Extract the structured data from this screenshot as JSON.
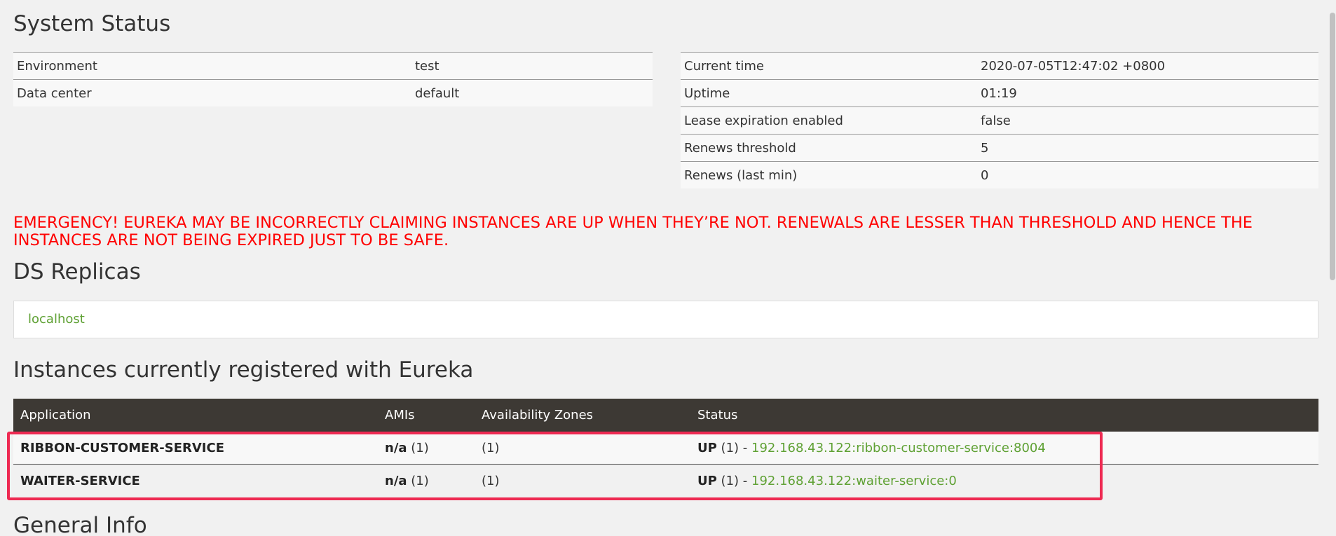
{
  "system_status": {
    "title": "System Status",
    "left_rows": [
      {
        "label": "Environment",
        "value": "test"
      },
      {
        "label": "Data center",
        "value": "default"
      }
    ],
    "right_rows": [
      {
        "label": "Current time",
        "value": "2020-07-05T12:47:02 +0800"
      },
      {
        "label": "Uptime",
        "value": "01:19"
      },
      {
        "label": "Lease expiration enabled",
        "value": "false"
      },
      {
        "label": "Renews threshold",
        "value": "5"
      },
      {
        "label": "Renews (last min)",
        "value": "0"
      }
    ]
  },
  "emergency_message": "EMERGENCY! EUREKA MAY BE INCORRECTLY CLAIMING INSTANCES ARE UP WHEN THEY’RE NOT. RENEWALS ARE LESSER THAN THRESHOLD AND HENCE THE INSTANCES ARE NOT BEING EXPIRED JUST TO BE SAFE.",
  "ds_replicas": {
    "title": "DS Replicas",
    "items": [
      "localhost"
    ]
  },
  "instances": {
    "title": "Instances currently registered with Eureka",
    "columns": [
      "Application",
      "AMIs",
      "Availability Zones",
      "Status"
    ],
    "rows": [
      {
        "application": "RIBBON-CUSTOMER-SERVICE",
        "ami_value": "n/a",
        "ami_count": "(1)",
        "zones": "(1)",
        "status": "UP",
        "status_count": "(1) -",
        "instance_link": "192.168.43.122:ribbon-customer-service:8004"
      },
      {
        "application": "WAITER-SERVICE",
        "ami_value": "n/a",
        "ami_count": "(1)",
        "zones": "(1)",
        "status": "UP",
        "status_count": "(1) -",
        "instance_link": "192.168.43.122:waiter-service:0"
      }
    ]
  },
  "general_info": {
    "title": "General Info"
  },
  "colors": {
    "background": "#f1f1f1",
    "emergency": "#ff0000",
    "link": "#5fa134",
    "table_header": "#3d3934",
    "highlight_border": "#ee2a52"
  }
}
